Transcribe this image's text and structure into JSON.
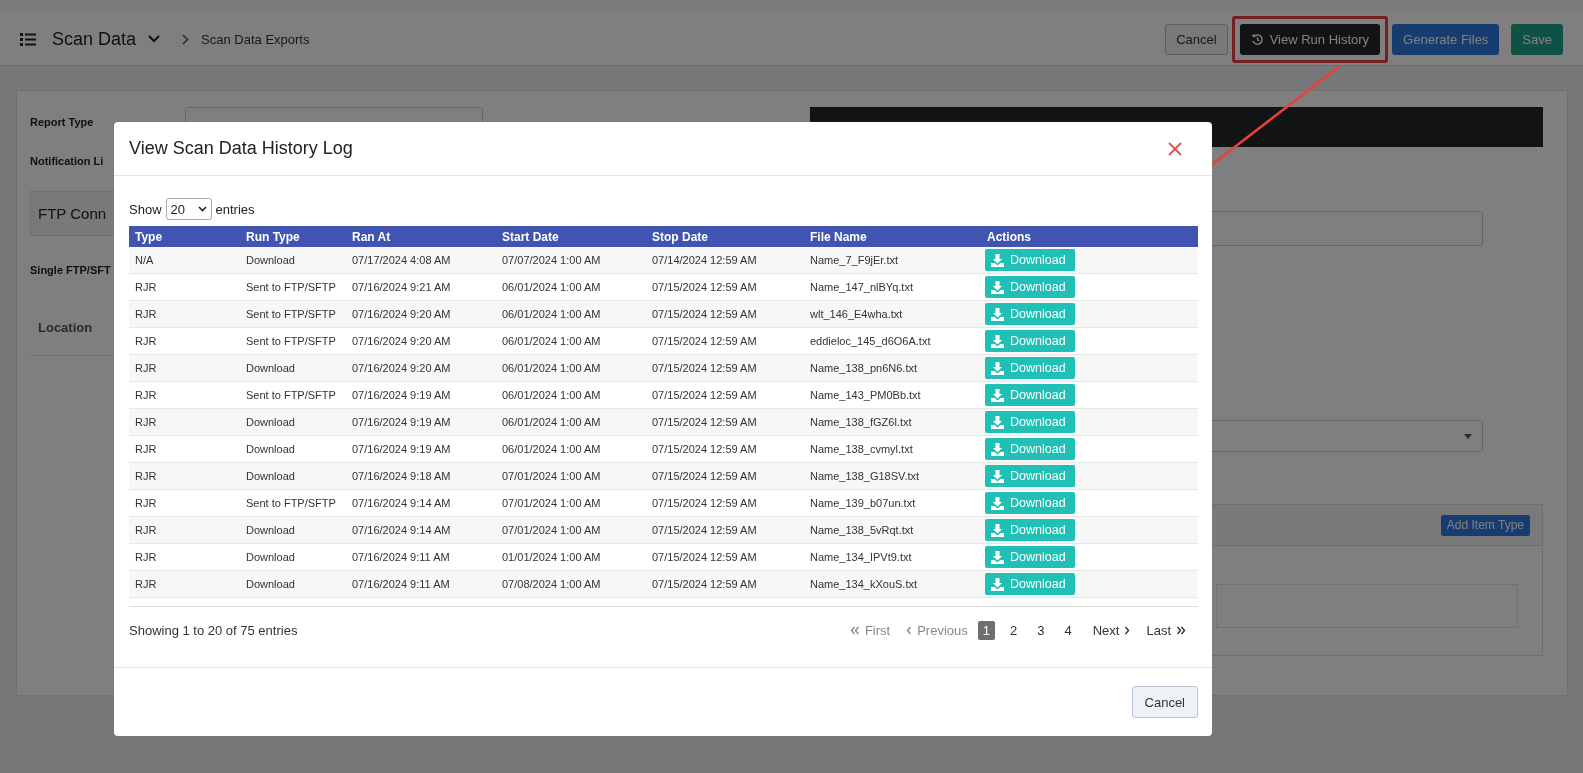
{
  "header": {
    "title": "Scan Data",
    "breadcrumb": "Scan Data Exports",
    "buttons": [
      {
        "label": "Cancel",
        "kind": "cancel",
        "highlighted": false
      },
      {
        "label": "View Run History",
        "kind": "history",
        "highlighted": true
      },
      {
        "label": "Generate Files",
        "kind": "generate",
        "highlighted": false
      },
      {
        "label": "Save",
        "kind": "save",
        "highlighted": false
      }
    ]
  },
  "form": {
    "report_type_label": "Report Type",
    "notification_label": "Notification Li",
    "ftp_section": "FTP Conn",
    "single_ftp_label": "Single FTP/SFT",
    "location_header": "Location",
    "add_button": "Add Item Type"
  },
  "modal": {
    "title": "View Scan Data History Log",
    "show_label": "Show",
    "page_size": "20",
    "entries_label": "entries",
    "columns": [
      "Type",
      "Run Type",
      "Ran At",
      "Start Date",
      "Stop Date",
      "File Name",
      "Actions"
    ],
    "rows": [
      {
        "cells": [
          "N/A",
          "Download",
          "07/17/2024 4:08 AM",
          "07/07/2024 1:00 AM",
          "07/14/2024 12:59 AM",
          "Name_7_F9jEr.txt"
        ],
        "action": "Download"
      },
      {
        "cells": [
          "RJR",
          "Sent to FTP/SFTP",
          "07/16/2024 9:21 AM",
          "06/01/2024 1:00 AM",
          "07/15/2024 12:59 AM",
          "Name_147_nlBYq.txt"
        ],
        "action": "Download"
      },
      {
        "cells": [
          "RJR",
          "Sent to FTP/SFTP",
          "07/16/2024 9:20 AM",
          "06/01/2024 1:00 AM",
          "07/15/2024 12:59 AM",
          "wlt_146_E4wha.txt"
        ],
        "action": "Download"
      },
      {
        "cells": [
          "RJR",
          "Sent to FTP/SFTP",
          "07/16/2024 9:20 AM",
          "06/01/2024 1:00 AM",
          "07/15/2024 12:59 AM",
          "eddieloc_145_d6O6A.txt"
        ],
        "action": "Download"
      },
      {
        "cells": [
          "RJR",
          "Download",
          "07/16/2024 9:20 AM",
          "06/01/2024 1:00 AM",
          "07/15/2024 12:59 AM",
          "Name_138_pn6N6.txt"
        ],
        "action": "Download"
      },
      {
        "cells": [
          "RJR",
          "Sent to FTP/SFTP",
          "07/16/2024 9:19 AM",
          "06/01/2024 1:00 AM",
          "07/15/2024 12:59 AM",
          "Name_143_PM0Bb.txt"
        ],
        "action": "Download"
      },
      {
        "cells": [
          "RJR",
          "Download",
          "07/16/2024 9:19 AM",
          "06/01/2024 1:00 AM",
          "07/15/2024 12:59 AM",
          "Name_138_fGZ6l.txt"
        ],
        "action": "Download"
      },
      {
        "cells": [
          "RJR",
          "Download",
          "07/16/2024 9:19 AM",
          "06/01/2024 1:00 AM",
          "07/15/2024 12:59 AM",
          "Name_138_cvmyl.txt"
        ],
        "action": "Download"
      },
      {
        "cells": [
          "RJR",
          "Download",
          "07/16/2024 9:18 AM",
          "07/01/2024 1:00 AM",
          "07/15/2024 12:59 AM",
          "Name_138_G18SV.txt"
        ],
        "action": "Download"
      },
      {
        "cells": [
          "RJR",
          "Sent to FTP/SFTP",
          "07/16/2024 9:14 AM",
          "07/01/2024 1:00 AM",
          "07/15/2024 12:59 AM",
          "Name_139_b07un.txt"
        ],
        "action": "Download"
      },
      {
        "cells": [
          "RJR",
          "Download",
          "07/16/2024 9:14 AM",
          "07/01/2024 1:00 AM",
          "07/15/2024 12:59 AM",
          "Name_138_5vRqt.txt"
        ],
        "action": "Download"
      },
      {
        "cells": [
          "RJR",
          "Download",
          "07/16/2024 9:11 AM",
          "01/01/2024 1:00 AM",
          "07/15/2024 12:59 AM",
          "Name_134_IPVt9.txt"
        ],
        "action": "Download"
      },
      {
        "cells": [
          "RJR",
          "Download",
          "07/16/2024 9:11 AM",
          "07/08/2024 1:00 AM",
          "07/15/2024 12:59 AM",
          "Name_134_kXouS.txt"
        ],
        "action": "Download"
      }
    ],
    "info": "Showing 1 to 20 of 75 entries",
    "pagination": {
      "first": {
        "label": "First",
        "disabled": true
      },
      "previous": {
        "label": "Previous",
        "disabled": true
      },
      "pages": [
        {
          "label": "1",
          "selected": true
        },
        {
          "label": "2",
          "selected": false
        },
        {
          "label": "3",
          "selected": false
        },
        {
          "label": "4",
          "selected": false
        }
      ],
      "next": {
        "label": "Next",
        "disabled": false
      },
      "last": {
        "label": "Last",
        "disabled": false
      }
    },
    "footer_button": "Cancel"
  }
}
